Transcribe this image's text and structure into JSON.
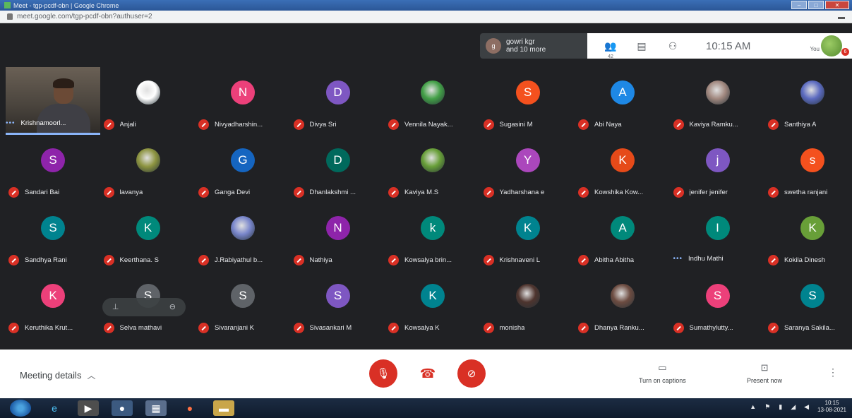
{
  "browser": {
    "tab_title": "Meet - tgp-pcdf-obn | Google Chrome",
    "url": "meet.google.com/tgp-pcdf-obn?authuser=2",
    "window_buttons": [
      "–",
      "□",
      "✕"
    ]
  },
  "top_bar": {
    "presenter_line1": "gowri kgr",
    "presenter_line2": "and 10 more",
    "people_count": "42",
    "clock": "10:15 AM",
    "you_label": "You",
    "you_badge": "6"
  },
  "self_tile": {
    "name": "Krishnamoorl..."
  },
  "participants": [
    {
      "name": "Anjali",
      "initial": "",
      "color": "#ffffff",
      "photo": true
    },
    {
      "name": "Nivyadharshin...",
      "initial": "N",
      "color": "#ec407a"
    },
    {
      "name": "Divya Sri",
      "initial": "D",
      "color": "#7e57c2"
    },
    {
      "name": "Vennila Nayak...",
      "initial": "",
      "color": "#43a047",
      "photo": true
    },
    {
      "name": "Sugasini M",
      "initial": "S",
      "color": "#f4511e"
    },
    {
      "name": "Abi Naya",
      "initial": "A",
      "color": "#1e88e5"
    },
    {
      "name": "Kaviya Ramku...",
      "initial": "",
      "color": "#a1887f",
      "photo": true
    },
    {
      "name": "Santhiya A",
      "initial": "",
      "color": "#5c6bc0",
      "photo": true
    },
    {
      "name": "Sandari Bai",
      "initial": "S",
      "color": "#8e24aa"
    },
    {
      "name": "lavanya",
      "initial": "",
      "color": "#8d9440",
      "photo": true
    },
    {
      "name": "Ganga Devi",
      "initial": "G",
      "color": "#1565c0"
    },
    {
      "name": "Dhanlakshmi ...",
      "initial": "D",
      "color": "#00695c"
    },
    {
      "name": "Kaviya M.S",
      "initial": "",
      "color": "#689f38",
      "photo": true
    },
    {
      "name": "Yadharshana e",
      "initial": "Y",
      "color": "#ab47bc"
    },
    {
      "name": "Kowshika Kow...",
      "initial": "K",
      "color": "#e64a19"
    },
    {
      "name": "jenifer jenifer",
      "initial": "j",
      "color": "#7e57c2"
    },
    {
      "name": "swetha ranjani",
      "initial": "s",
      "color": "#f4511e"
    },
    {
      "name": "Sandhya Rani",
      "initial": "S",
      "color": "#00838f"
    },
    {
      "name": "Keerthana. S",
      "initial": "K",
      "color": "#00897b"
    },
    {
      "name": "J.Rabiyathul b...",
      "initial": "",
      "color": "#7986cb",
      "photo": true
    },
    {
      "name": "Nathiya",
      "initial": "N",
      "color": "#8e24aa"
    },
    {
      "name": "Kowsalya brin...",
      "initial": "k",
      "color": "#00897b"
    },
    {
      "name": "Krishnaveni L",
      "initial": "K",
      "color": "#00838f"
    },
    {
      "name": "Abitha Abitha",
      "initial": "A",
      "color": "#00897b"
    },
    {
      "name": "Indhu Mathi",
      "initial": "I",
      "color": "#00897b",
      "unmuted": true
    },
    {
      "name": "Kokila Dinesh",
      "initial": "K",
      "color": "#689f38"
    },
    {
      "name": "Keruthika Krut...",
      "initial": "K",
      "color": "#ec407a"
    },
    {
      "name": "Selva mathavi",
      "initial": "S",
      "color": "#5f6368",
      "hover": true
    },
    {
      "name": "Sivaranjani K",
      "initial": "S",
      "color": "#5f6368"
    },
    {
      "name": "Sivasankari M",
      "initial": "S",
      "color": "#7e57c2"
    },
    {
      "name": "Kowsalya K",
      "initial": "K",
      "color": "#00838f"
    },
    {
      "name": "monisha",
      "initial": "",
      "color": "#4e342e",
      "photo": true
    },
    {
      "name": "Dhanya Ranku...",
      "initial": "",
      "color": "#6d4c41",
      "photo": true
    },
    {
      "name": "Sumathylutty...",
      "initial": "S",
      "color": "#ec407a"
    },
    {
      "name": "Saranya Sakila...",
      "initial": "S",
      "color": "#00838f"
    }
  ],
  "hover_controls": [
    "⊥",
    "⊖"
  ],
  "bottom_bar": {
    "meeting_details": "Meeting details",
    "captions": "Turn on captions",
    "present": "Present now"
  },
  "taskbar": {
    "time": "10:15",
    "date": "13-08-2021"
  }
}
